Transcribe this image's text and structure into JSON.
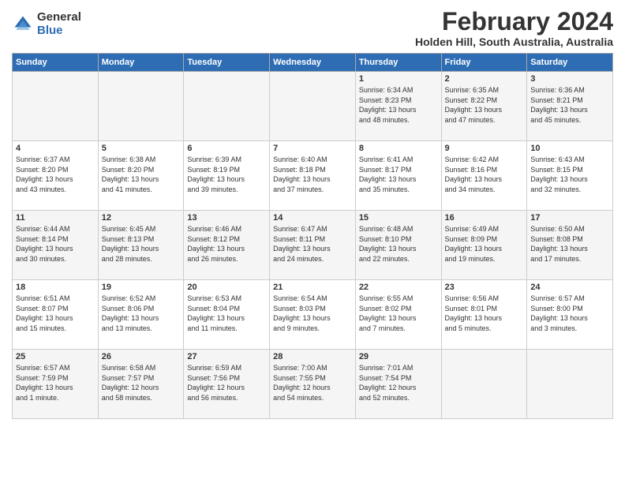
{
  "logo": {
    "general": "General",
    "blue": "Blue"
  },
  "header": {
    "month": "February 2024",
    "location": "Holden Hill, South Australia, Australia"
  },
  "days_of_week": [
    "Sunday",
    "Monday",
    "Tuesday",
    "Wednesday",
    "Thursday",
    "Friday",
    "Saturday"
  ],
  "weeks": [
    [
      {
        "day": "",
        "info": ""
      },
      {
        "day": "",
        "info": ""
      },
      {
        "day": "",
        "info": ""
      },
      {
        "day": "",
        "info": ""
      },
      {
        "day": "1",
        "info": "Sunrise: 6:34 AM\nSunset: 8:23 PM\nDaylight: 13 hours\nand 48 minutes."
      },
      {
        "day": "2",
        "info": "Sunrise: 6:35 AM\nSunset: 8:22 PM\nDaylight: 13 hours\nand 47 minutes."
      },
      {
        "day": "3",
        "info": "Sunrise: 6:36 AM\nSunset: 8:21 PM\nDaylight: 13 hours\nand 45 minutes."
      }
    ],
    [
      {
        "day": "4",
        "info": "Sunrise: 6:37 AM\nSunset: 8:20 PM\nDaylight: 13 hours\nand 43 minutes."
      },
      {
        "day": "5",
        "info": "Sunrise: 6:38 AM\nSunset: 8:20 PM\nDaylight: 13 hours\nand 41 minutes."
      },
      {
        "day": "6",
        "info": "Sunrise: 6:39 AM\nSunset: 8:19 PM\nDaylight: 13 hours\nand 39 minutes."
      },
      {
        "day": "7",
        "info": "Sunrise: 6:40 AM\nSunset: 8:18 PM\nDaylight: 13 hours\nand 37 minutes."
      },
      {
        "day": "8",
        "info": "Sunrise: 6:41 AM\nSunset: 8:17 PM\nDaylight: 13 hours\nand 35 minutes."
      },
      {
        "day": "9",
        "info": "Sunrise: 6:42 AM\nSunset: 8:16 PM\nDaylight: 13 hours\nand 34 minutes."
      },
      {
        "day": "10",
        "info": "Sunrise: 6:43 AM\nSunset: 8:15 PM\nDaylight: 13 hours\nand 32 minutes."
      }
    ],
    [
      {
        "day": "11",
        "info": "Sunrise: 6:44 AM\nSunset: 8:14 PM\nDaylight: 13 hours\nand 30 minutes."
      },
      {
        "day": "12",
        "info": "Sunrise: 6:45 AM\nSunset: 8:13 PM\nDaylight: 13 hours\nand 28 minutes."
      },
      {
        "day": "13",
        "info": "Sunrise: 6:46 AM\nSunset: 8:12 PM\nDaylight: 13 hours\nand 26 minutes."
      },
      {
        "day": "14",
        "info": "Sunrise: 6:47 AM\nSunset: 8:11 PM\nDaylight: 13 hours\nand 24 minutes."
      },
      {
        "day": "15",
        "info": "Sunrise: 6:48 AM\nSunset: 8:10 PM\nDaylight: 13 hours\nand 22 minutes."
      },
      {
        "day": "16",
        "info": "Sunrise: 6:49 AM\nSunset: 8:09 PM\nDaylight: 13 hours\nand 19 minutes."
      },
      {
        "day": "17",
        "info": "Sunrise: 6:50 AM\nSunset: 8:08 PM\nDaylight: 13 hours\nand 17 minutes."
      }
    ],
    [
      {
        "day": "18",
        "info": "Sunrise: 6:51 AM\nSunset: 8:07 PM\nDaylight: 13 hours\nand 15 minutes."
      },
      {
        "day": "19",
        "info": "Sunrise: 6:52 AM\nSunset: 8:06 PM\nDaylight: 13 hours\nand 13 minutes."
      },
      {
        "day": "20",
        "info": "Sunrise: 6:53 AM\nSunset: 8:04 PM\nDaylight: 13 hours\nand 11 minutes."
      },
      {
        "day": "21",
        "info": "Sunrise: 6:54 AM\nSunset: 8:03 PM\nDaylight: 13 hours\nand 9 minutes."
      },
      {
        "day": "22",
        "info": "Sunrise: 6:55 AM\nSunset: 8:02 PM\nDaylight: 13 hours\nand 7 minutes."
      },
      {
        "day": "23",
        "info": "Sunrise: 6:56 AM\nSunset: 8:01 PM\nDaylight: 13 hours\nand 5 minutes."
      },
      {
        "day": "24",
        "info": "Sunrise: 6:57 AM\nSunset: 8:00 PM\nDaylight: 13 hours\nand 3 minutes."
      }
    ],
    [
      {
        "day": "25",
        "info": "Sunrise: 6:57 AM\nSunset: 7:59 PM\nDaylight: 13 hours\nand 1 minute."
      },
      {
        "day": "26",
        "info": "Sunrise: 6:58 AM\nSunset: 7:57 PM\nDaylight: 12 hours\nand 58 minutes."
      },
      {
        "day": "27",
        "info": "Sunrise: 6:59 AM\nSunset: 7:56 PM\nDaylight: 12 hours\nand 56 minutes."
      },
      {
        "day": "28",
        "info": "Sunrise: 7:00 AM\nSunset: 7:55 PM\nDaylight: 12 hours\nand 54 minutes."
      },
      {
        "day": "29",
        "info": "Sunrise: 7:01 AM\nSunset: 7:54 PM\nDaylight: 12 hours\nand 52 minutes."
      },
      {
        "day": "",
        "info": ""
      },
      {
        "day": "",
        "info": ""
      }
    ]
  ]
}
